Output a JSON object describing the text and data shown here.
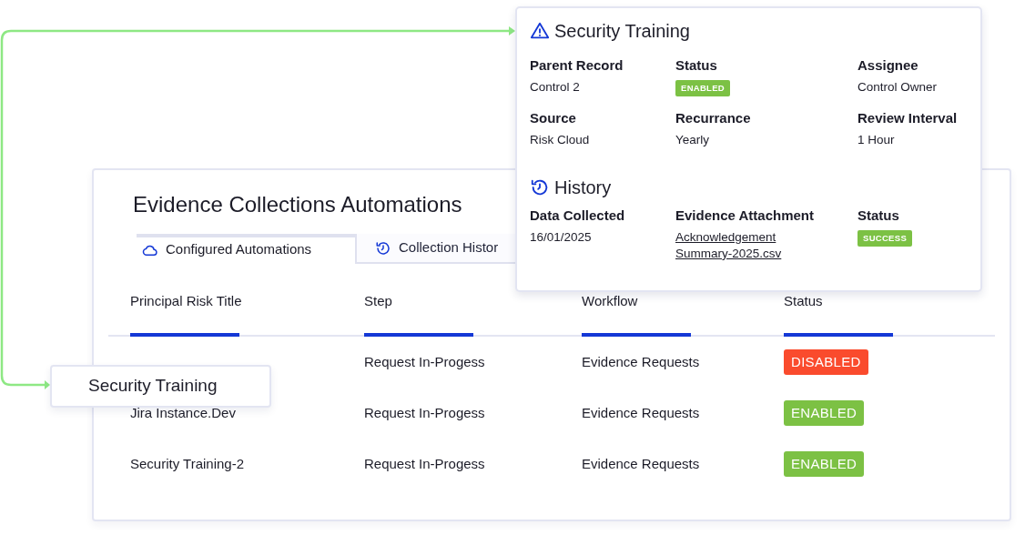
{
  "panel": {
    "title": "Evidence Collections Automations",
    "tabs": [
      {
        "label": "Configured Automations",
        "selected": true
      },
      {
        "label": "Collection Histor",
        "selected": false
      }
    ],
    "table": {
      "columns": [
        "Principal Risk Title",
        "Step",
        "Workflow",
        "Status"
      ],
      "rows": [
        {
          "step": "Request In-Progess",
          "workflow": "Evidence Requests",
          "status": "DISABLED",
          "color": "#fa4b2d"
        },
        {
          "title": "Jira Instance.Dev",
          "step": "Request In-Progess",
          "workflow": "Evidence Requests",
          "status": "ENABLED",
          "color": "#7cc144"
        },
        {
          "title": "Security Training-2",
          "step": "Request In-Progess",
          "workflow": "Evidence Requests",
          "status": "ENABLED",
          "color": "#7cc144"
        }
      ]
    }
  },
  "callout": {
    "label": "Security Training"
  },
  "detail_card": {
    "title": "Security Training",
    "fields": [
      {
        "label": "Parent Record",
        "value": "Control 2",
        "kind": "text"
      },
      {
        "label": "Status",
        "value": "ENABLED",
        "kind": "badge",
        "color": "#7cc144"
      },
      {
        "label": "Assignee",
        "value": "Control Owner",
        "kind": "text"
      },
      {
        "label": "Source",
        "value": "Risk Cloud",
        "kind": "text"
      },
      {
        "label": "Recurrance",
        "value": "Yearly",
        "kind": "text"
      },
      {
        "label": "Review Interval",
        "value": "1 Hour",
        "kind": "text"
      }
    ],
    "history": {
      "title": "History",
      "fields": [
        {
          "label": "Data Collected",
          "value": "16/01/2025",
          "kind": "text"
        },
        {
          "label": "Evidence Attachment",
          "value": "Acknowledgement Summary-2025.csv",
          "kind": "link"
        },
        {
          "label": "Status",
          "value": "SUCCESS",
          "kind": "badge",
          "color": "#7cc144"
        }
      ]
    }
  }
}
